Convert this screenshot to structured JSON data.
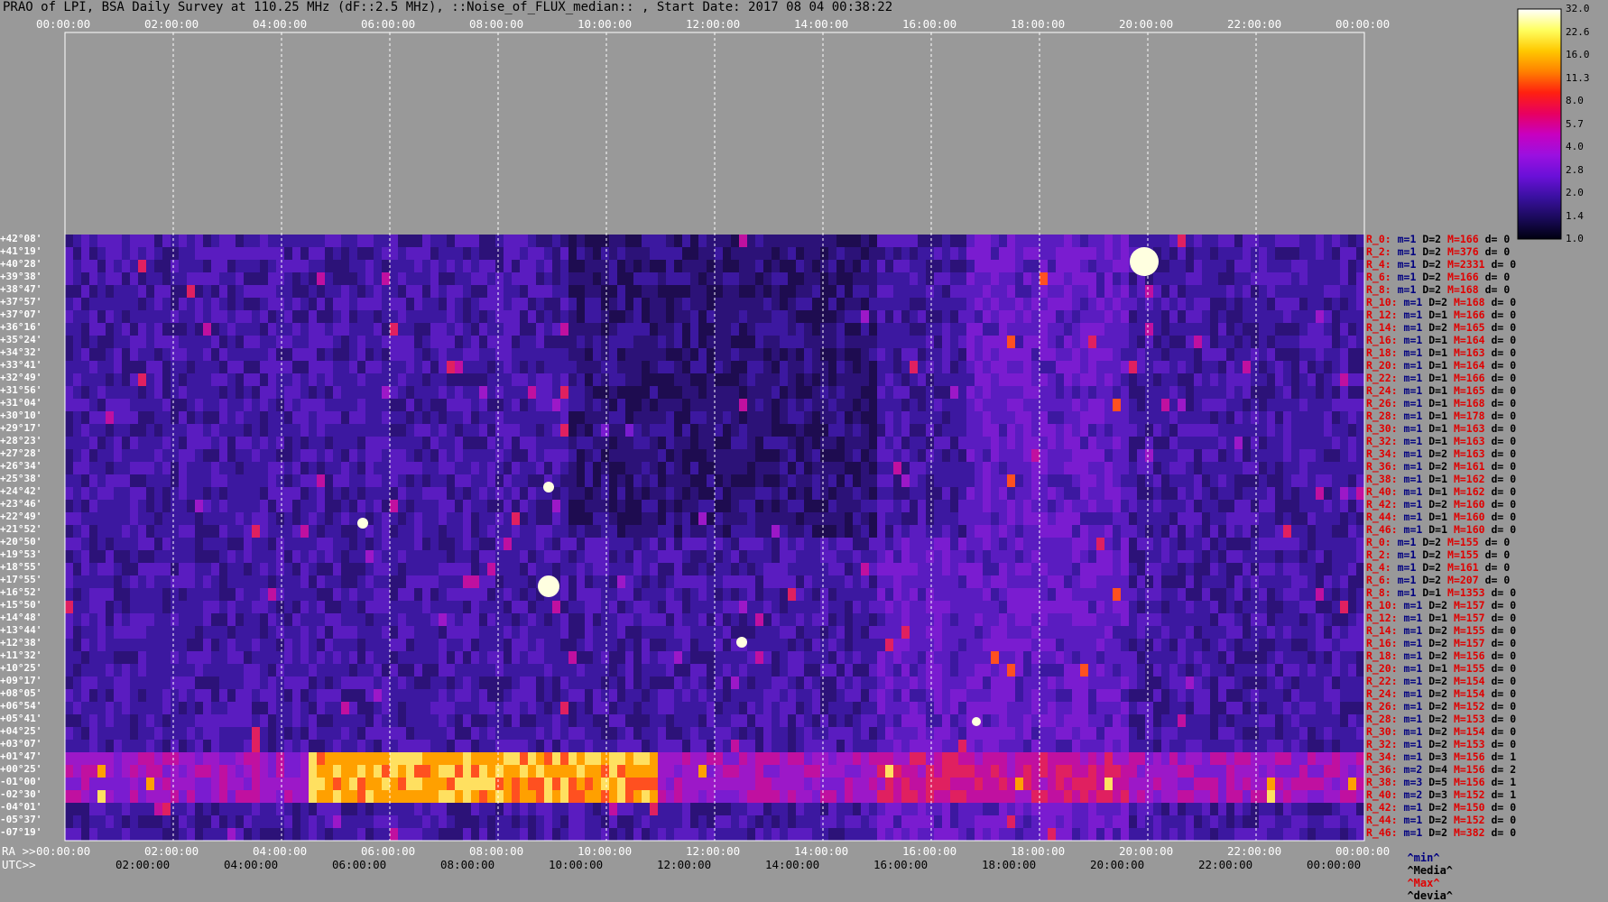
{
  "title": "PRAO of LPI, BSA Daily Survey at 110.25 MHz (dF::2.5 MHz), ::Noise_of_FLUX_median:: , Start Date: 2017 08 04 00:38:22",
  "chart_data": {
    "type": "heatmap",
    "title": "PRAO of LPI, BSA Daily Survey at 110.25 MHz (dF::2.5 MHz), ::Noise_of_FLUX_median:: , Start Date: 2017 08 04 00:38:22",
    "x_top_ticks": [
      "00:00:00",
      "02:00:00",
      "04:00:00",
      "06:00:00",
      "08:00:00",
      "10:00:00",
      "12:00:00",
      "14:00:00",
      "16:00:00",
      "18:00:00",
      "20:00:00",
      "22:00:00",
      "00:00:00"
    ],
    "ra_label": "RA >>",
    "ra_ticks": [
      "00:00:00",
      "02:00:00",
      "04:00:00",
      "06:00:00",
      "08:00:00",
      "10:00:00",
      "12:00:00",
      "14:00:00",
      "16:00:00",
      "18:00:00",
      "20:00:00",
      "22:00:00",
      "00:00:00"
    ],
    "utc_label": "UTC>>",
    "utc_ticks": [
      "02:00:00",
      "04:00:00",
      "06:00:00",
      "08:00:00",
      "10:00:00",
      "12:00:00",
      "14:00:00",
      "16:00:00",
      "18:00:00",
      "20:00:00",
      "22:00:00",
      "00:00:00"
    ],
    "declinations": [
      "+42°08'",
      "+41°19'",
      "+40°28'",
      "+39°38'",
      "+38°47'",
      "+37°57'",
      "+37°07'",
      "+36°16'",
      "+35°24'",
      "+34°32'",
      "+33°41'",
      "+32°49'",
      "+31°56'",
      "+31°04'",
      "+30°10'",
      "+29°17'",
      "+28°23'",
      "+27°28'",
      "+26°34'",
      "+25°38'",
      "+24°42'",
      "+23°46'",
      "+22°49'",
      "+21°52'",
      "+20°50'",
      "+19°53'",
      "+18°55'",
      "+17°55'",
      "+16°52'",
      "+15°50'",
      "+14°48'",
      "+13°44'",
      "+12°38'",
      "+11°32'",
      "+10°25'",
      "+09°17'",
      "+08°05'",
      "+06°54'",
      "+05°41'",
      "+04°25'",
      "+03°07'",
      "+01°47'",
      "+00°25'",
      "-01°00'",
      "-02°30'",
      "-04°01'",
      "-05°37'",
      "-07°19'"
    ],
    "rows": [
      {
        "r": "R_0:",
        "m": "m=1",
        "d": "D=2",
        "M": "M=166",
        "dd": "d= 0"
      },
      {
        "r": "R_2:",
        "m": "m=1",
        "d": "D=2",
        "M": "M=376",
        "dd": "d= 0"
      },
      {
        "r": "R_4:",
        "m": "m=1",
        "d": "D=2",
        "M": "M=2331",
        "dd": "d= 0"
      },
      {
        "r": "R_6:",
        "m": "m=1",
        "d": "D=2",
        "M": "M=166",
        "dd": "d= 0"
      },
      {
        "r": "R_8:",
        "m": "m=1",
        "d": "D=2",
        "M": "M=168",
        "dd": "d= 0"
      },
      {
        "r": "R_10:",
        "m": "m=1",
        "d": "D=2",
        "M": "M=168",
        "dd": "d= 0"
      },
      {
        "r": "R_12:",
        "m": "m=1",
        "d": "D=1",
        "M": "M=166",
        "dd": "d= 0"
      },
      {
        "r": "R_14:",
        "m": "m=1",
        "d": "D=2",
        "M": "M=165",
        "dd": "d= 0"
      },
      {
        "r": "R_16:",
        "m": "m=1",
        "d": "D=1",
        "M": "M=164",
        "dd": "d= 0"
      },
      {
        "r": "R_18:",
        "m": "m=1",
        "d": "D=1",
        "M": "M=163",
        "dd": "d= 0"
      },
      {
        "r": "R_20:",
        "m": "m=1",
        "d": "D=1",
        "M": "M=164",
        "dd": "d= 0"
      },
      {
        "r": "R_22:",
        "m": "m=1",
        "d": "D=1",
        "M": "M=166",
        "dd": "d= 0"
      },
      {
        "r": "R_24:",
        "m": "m=1",
        "d": "D=1",
        "M": "M=165",
        "dd": "d= 0"
      },
      {
        "r": "R_26:",
        "m": "m=1",
        "d": "D=1",
        "M": "M=168",
        "dd": "d= 0"
      },
      {
        "r": "R_28:",
        "m": "m=1",
        "d": "D=1",
        "M": "M=178",
        "dd": "d= 0"
      },
      {
        "r": "R_30:",
        "m": "m=1",
        "d": "D=1",
        "M": "M=163",
        "dd": "d= 0"
      },
      {
        "r": "R_32:",
        "m": "m=1",
        "d": "D=1",
        "M": "M=163",
        "dd": "d= 0"
      },
      {
        "r": "R_34:",
        "m": "m=1",
        "d": "D=2",
        "M": "M=163",
        "dd": "d= 0"
      },
      {
        "r": "R_36:",
        "m": "m=1",
        "d": "D=2",
        "M": "M=161",
        "dd": "d= 0"
      },
      {
        "r": "R_38:",
        "m": "m=1",
        "d": "D=1",
        "M": "M=162",
        "dd": "d= 0"
      },
      {
        "r": "R_40:",
        "m": "m=1",
        "d": "D=1",
        "M": "M=162",
        "dd": "d= 0"
      },
      {
        "r": "R_42:",
        "m": "m=1",
        "d": "D=2",
        "M": "M=160",
        "dd": "d= 0"
      },
      {
        "r": "R_44:",
        "m": "m=1",
        "d": "D=1",
        "M": "M=160",
        "dd": "d= 0"
      },
      {
        "r": "R_46:",
        "m": "m=1",
        "d": "D=1",
        "M": "M=160",
        "dd": "d= 0"
      },
      {
        "r": "R_0:",
        "m": "m=1",
        "d": "D=2",
        "M": "M=155",
        "dd": "d= 0"
      },
      {
        "r": "R_2:",
        "m": "m=1",
        "d": "D=2",
        "M": "M=155",
        "dd": "d= 0"
      },
      {
        "r": "R_4:",
        "m": "m=1",
        "d": "D=2",
        "M": "M=161",
        "dd": "d= 0"
      },
      {
        "r": "R_6:",
        "m": "m=1",
        "d": "D=2",
        "M": "M=207",
        "dd": "d= 0"
      },
      {
        "r": "R_8:",
        "m": "m=1",
        "d": "D=1",
        "M": "M=1353",
        "dd": "d= 0"
      },
      {
        "r": "R_10:",
        "m": "m=1",
        "d": "D=2",
        "M": "M=157",
        "dd": "d= 0"
      },
      {
        "r": "R_12:",
        "m": "m=1",
        "d": "D=1",
        "M": "M=157",
        "dd": "d= 0"
      },
      {
        "r": "R_14:",
        "m": "m=1",
        "d": "D=2",
        "M": "M=155",
        "dd": "d= 0"
      },
      {
        "r": "R_16:",
        "m": "m=1",
        "d": "D=2",
        "M": "M=157",
        "dd": "d= 0"
      },
      {
        "r": "R_18:",
        "m": "m=1",
        "d": "D=2",
        "M": "M=156",
        "dd": "d= 0"
      },
      {
        "r": "R_20:",
        "m": "m=1",
        "d": "D=1",
        "M": "M=155",
        "dd": "d= 0"
      },
      {
        "r": "R_22:",
        "m": "m=1",
        "d": "D=2",
        "M": "M=154",
        "dd": "d= 0"
      },
      {
        "r": "R_24:",
        "m": "m=1",
        "d": "D=2",
        "M": "M=154",
        "dd": "d= 0"
      },
      {
        "r": "R_26:",
        "m": "m=1",
        "d": "D=2",
        "M": "M=152",
        "dd": "d= 0"
      },
      {
        "r": "R_28:",
        "m": "m=1",
        "d": "D=2",
        "M": "M=153",
        "dd": "d= 0"
      },
      {
        "r": "R_30:",
        "m": "m=1",
        "d": "D=2",
        "M": "M=154",
        "dd": "d= 0"
      },
      {
        "r": "R_32:",
        "m": "m=1",
        "d": "D=2",
        "M": "M=153",
        "dd": "d= 0"
      },
      {
        "r": "R_34:",
        "m": "m=1",
        "d": "D=3",
        "M": "M=156",
        "dd": "d= 1"
      },
      {
        "r": "R_36:",
        "m": "m=2",
        "d": "D=4",
        "M": "M=156",
        "dd": "d= 2"
      },
      {
        "r": "R_38:",
        "m": "m=3",
        "d": "D=5",
        "M": "M=156",
        "dd": "d= 1"
      },
      {
        "r": "R_40:",
        "m": "m=2",
        "d": "D=3",
        "M": "M=152",
        "dd": "d= 1"
      },
      {
        "r": "R_42:",
        "m": "m=1",
        "d": "D=2",
        "M": "M=150",
        "dd": "d= 0"
      },
      {
        "r": "R_44:",
        "m": "m=1",
        "d": "D=2",
        "M": "M=152",
        "dd": "d= 0"
      },
      {
        "r": "R_46:",
        "m": "m=1",
        "d": "D=2",
        "M": "M=382",
        "dd": "d= 0"
      }
    ],
    "colorbar": {
      "ticks": [
        "32.0",
        "22.6",
        "16.0",
        "11.3",
        "8.0",
        "5.7",
        "4.0",
        "2.8",
        "2.0",
        "1.4",
        "1.0"
      ],
      "colors": [
        "#000010",
        "#1a0a5a",
        "#3a10a0",
        "#6a10d8",
        "#9a10e0",
        "#c800c0",
        "#e80060",
        "#ff2010",
        "#ff8000",
        "#ffc800",
        "#ffff60",
        "#ffffff"
      ]
    },
    "legend": {
      "min": "^min^",
      "media": "^Media^",
      "max": "^Max^",
      "devia": "^devia^"
    }
  }
}
